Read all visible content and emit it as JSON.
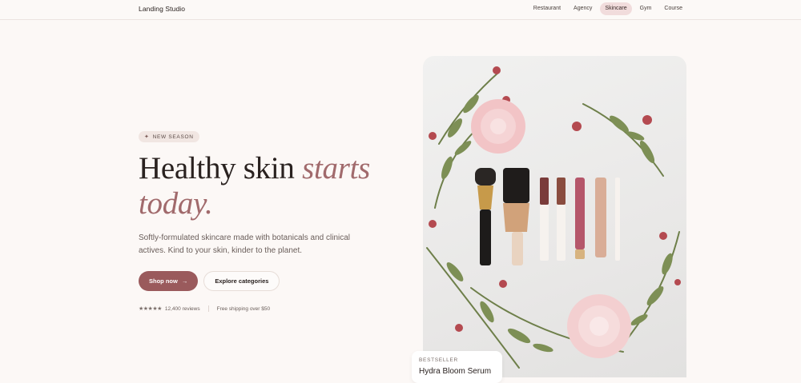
{
  "nav": {
    "brand": "Landing Studio",
    "links": [
      "Restaurant",
      "Agency",
      "Skincare",
      "Gym",
      "Course"
    ],
    "active": "Skincare"
  },
  "hero": {
    "badge": "NEW SEASON",
    "headline_plain": "Healthy skin ",
    "headline_accent_1": "starts",
    "headline_accent_2": "today.",
    "subtitle": "Softly-formulated skincare made with botanicals and clinical actives. Kind to your skin, kinder to the planet.",
    "primary_cta": "Shop now",
    "secondary_cta": "Explore categories",
    "rating_stars": "★★★★★",
    "reviews": "12,400 reviews",
    "shipping": "Free shipping over $50"
  },
  "product_card": {
    "kicker": "BESTSELLER",
    "title": "Hydra Bloom Serum"
  },
  "colors": {
    "accent": "#9a5a5c",
    "background": "#fcf8f6",
    "active_pill": "#f1dcdc"
  }
}
